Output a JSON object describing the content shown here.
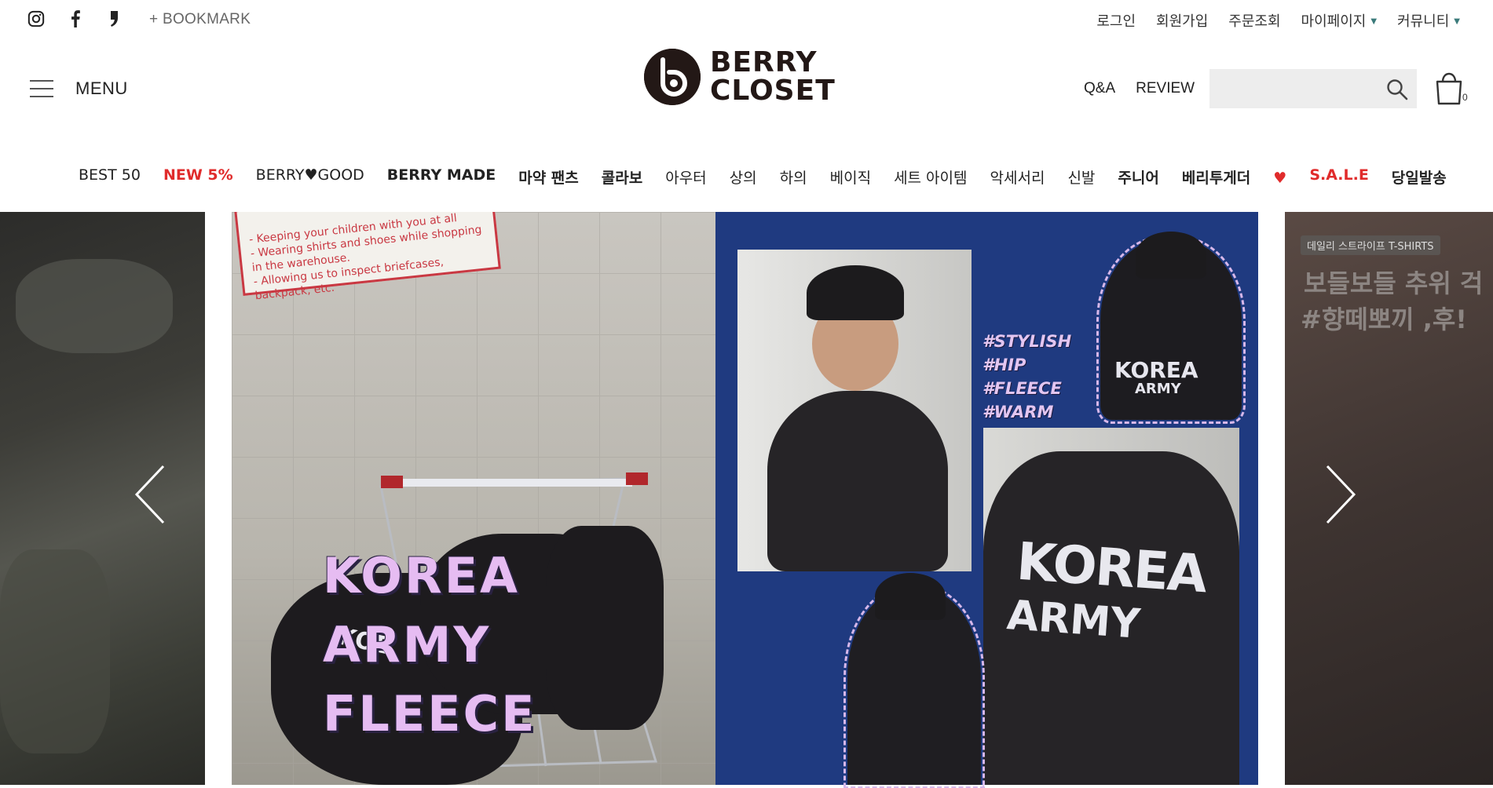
{
  "topbar": {
    "bookmark": "+ BOOKMARK",
    "links": [
      "로그인",
      "회원가입",
      "주문조회",
      "마이페이지",
      "커뮤니티"
    ]
  },
  "header": {
    "menu_label": "MENU",
    "logo_line1": "BERRY",
    "logo_line2": "CLOSET",
    "qa": "Q&A",
    "review": "REVIEW",
    "search_placeholder": "",
    "cart_count": "0"
  },
  "nav": {
    "items": [
      "BEST 50",
      "NEW 5%",
      "BERRY♥GOOD",
      "BERRY MADE",
      "마약 팬츠",
      "콜라보",
      "아우터",
      "상의",
      "하의",
      "베이직",
      "세트 아이템",
      "악세서리",
      "신발",
      "주니어",
      "베리투게더",
      "S.A.L.E",
      "당일발송"
    ]
  },
  "slider": {
    "sign_lines": [
      "- Keeping your children with you at all",
      "- Wearing shirts and shoes while shopping",
      "  in the warehouse.",
      "- Allowing us to inspect briefcases, backpack, etc."
    ],
    "hashtags": [
      "#STYLISH",
      "#HIP",
      "#FLEECE",
      "#WARM"
    ],
    "title_lines": [
      "KOREA",
      "ARMY",
      "FLEECE"
    ],
    "jacket_korea": "KOREA",
    "jacket_army": "ARMY",
    "pile_korea": "KOE",
    "right_tag": "데일리 스트라이프 T-SHIRTS",
    "right_line1": "보들보들 추위 걱",
    "right_line2": "#향떼뽀끼 ,후!"
  },
  "colors": {
    "accent_red": "#e02b2b",
    "panel_blue": "#1f3a80",
    "title_pink": "#e6bcf2"
  }
}
